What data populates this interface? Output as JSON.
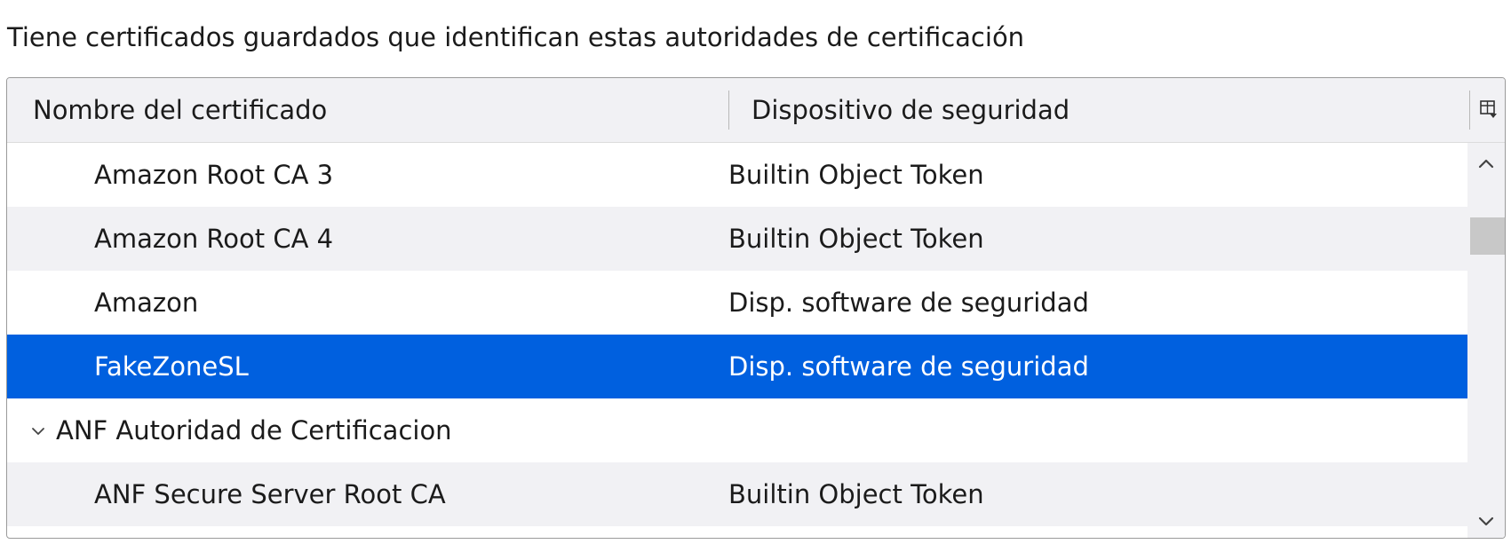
{
  "intro_text": "Tiene certificados guardados que identifican estas autoridades de certificación",
  "table": {
    "columns": [
      "Nombre del certificado",
      "Dispositivo de seguridad"
    ],
    "rows": [
      {
        "name": "Amazon Root CA 3",
        "device": "Builtin Object Token",
        "kind": "cert"
      },
      {
        "name": "Amazon Root CA 4",
        "device": "Builtin Object Token",
        "kind": "cert"
      },
      {
        "name": "Amazon",
        "device": "Disp. software de seguridad",
        "kind": "cert"
      },
      {
        "name": "FakeZoneSL",
        "device": "Disp. software de seguridad",
        "kind": "cert",
        "selected": true
      },
      {
        "name": "ANF Autoridad de Certificacion",
        "device": "",
        "kind": "group",
        "expanded": true
      },
      {
        "name": "ANF Secure Server Root CA",
        "device": "Builtin Object Token",
        "kind": "cert"
      }
    ]
  },
  "icons": {
    "column_picker": "column-picker-icon",
    "twisty": "chevron-down-icon",
    "scroll_up": "chevron-up-icon",
    "scroll_down": "chevron-down-icon"
  },
  "colors": {
    "selection": "#0060df",
    "header_bg": "#f1f1f4",
    "alt_row_bg": "#f1f1f4",
    "text": "#1b1b1b"
  }
}
